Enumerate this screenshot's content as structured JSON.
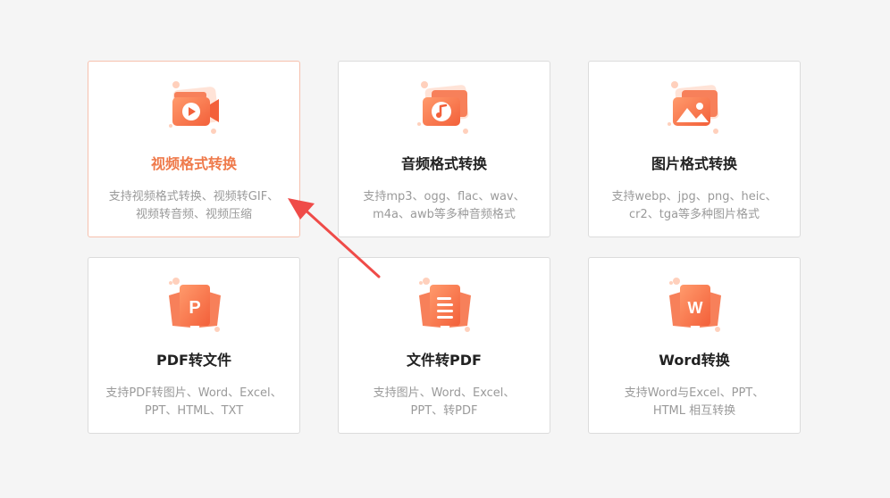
{
  "colors": {
    "accent": "#ef7a4b",
    "icon_light": "#ffd0bc",
    "icon_dark": "#f3603a",
    "arrow": "#ef4b48",
    "card_border": "#dcdcdc",
    "active_border": "#f6c1ae",
    "background": "#f5f5f5"
  },
  "cards": [
    {
      "title": "视频格式转换",
      "desc_line1": "支持视频格式转换、视频转GIF、",
      "desc_line2": "视频转音频、视频压缩",
      "icon": "video-camera-icon",
      "active": true
    },
    {
      "title": "音频格式转换",
      "desc_line1": "支持mp3、ogg、flac、wav、",
      "desc_line2": "m4a、awb等多种音频格式",
      "icon": "music-note-icon",
      "active": false
    },
    {
      "title": "图片格式转换",
      "desc_line1": "支持webp、jpg、png、heic、",
      "desc_line2": "cr2、tga等多种图片格式",
      "icon": "image-icon",
      "active": false
    },
    {
      "title": "PDF转文件",
      "desc_line1": "支持PDF转图片、Word、Excel、",
      "desc_line2": "PPT、HTML、TXT",
      "icon": "pdf-p-icon",
      "icon_letter": "P",
      "active": false
    },
    {
      "title": "文件转PDF",
      "desc_line1": "支持图片、Word、Excel、",
      "desc_line2": "PPT、转PDF",
      "icon": "document-lines-icon",
      "active": false
    },
    {
      "title": "Word转换",
      "desc_line1": "支持Word与Excel、PPT、",
      "desc_line2": "HTML 相互转换",
      "icon": "word-w-icon",
      "icon_letter": "W",
      "active": false
    }
  ]
}
